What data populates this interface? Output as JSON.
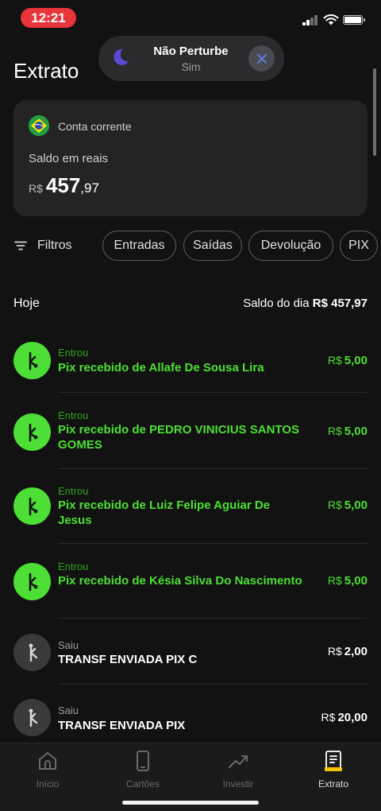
{
  "status_bar": {
    "time": "12:21"
  },
  "dnd": {
    "title": "Não Perturbe",
    "subtitle": "Sim"
  },
  "page": {
    "title": "Extrato"
  },
  "account": {
    "label": "Conta corrente",
    "balance_label": "Saldo em reais",
    "currency": "R$",
    "balance_int": "457",
    "balance_dec": ",97"
  },
  "filters": {
    "label": "Filtros",
    "chips": [
      "Entradas",
      "Saídas",
      "Devolução",
      "PIX"
    ]
  },
  "day": {
    "title": "Hoje",
    "balance_label": "Saldo do dia",
    "balance_value": "R$ 457,97"
  },
  "transactions": [
    {
      "type": "Entrou",
      "direction": "in",
      "description": "Pix recebido de Allafe De Sousa Lira",
      "currency": "R$",
      "amount": "5,00"
    },
    {
      "type": "Entrou",
      "direction": "in",
      "description": "Pix recebido de PEDRO VINICIUS SANTOS GOMES",
      "currency": "R$",
      "amount": "5,00"
    },
    {
      "type": "Entrou",
      "direction": "in",
      "description": "Pix recebido de Luiz Felipe Aguiar De Jesus",
      "currency": "R$",
      "amount": "5,00"
    },
    {
      "type": "Entrou",
      "direction": "in",
      "description": "Pix recebido de Késia Silva Do Nascimento",
      "currency": "R$",
      "amount": "5,00"
    },
    {
      "type": "Saiu",
      "direction": "out",
      "description": "TRANSF ENVIADA PIX C",
      "currency": "R$",
      "amount": "2,00"
    },
    {
      "type": "Saiu",
      "direction": "out",
      "description": "TRANSF ENVIADA PIX",
      "currency": "R$",
      "amount": "20,00"
    }
  ],
  "tabs": [
    {
      "label": "Início",
      "icon": "home-icon"
    },
    {
      "label": "Cartões",
      "icon": "phone-card-icon"
    },
    {
      "label": "Investir",
      "icon": "trend-up-icon"
    },
    {
      "label": "Extrato",
      "icon": "statement-icon",
      "active": true
    }
  ],
  "colors": {
    "background": "#121212",
    "card": "#242424",
    "income_green": "#4ddf35",
    "time_pill_red": "#e8343b",
    "active_tab_accent": "#f5c400"
  }
}
